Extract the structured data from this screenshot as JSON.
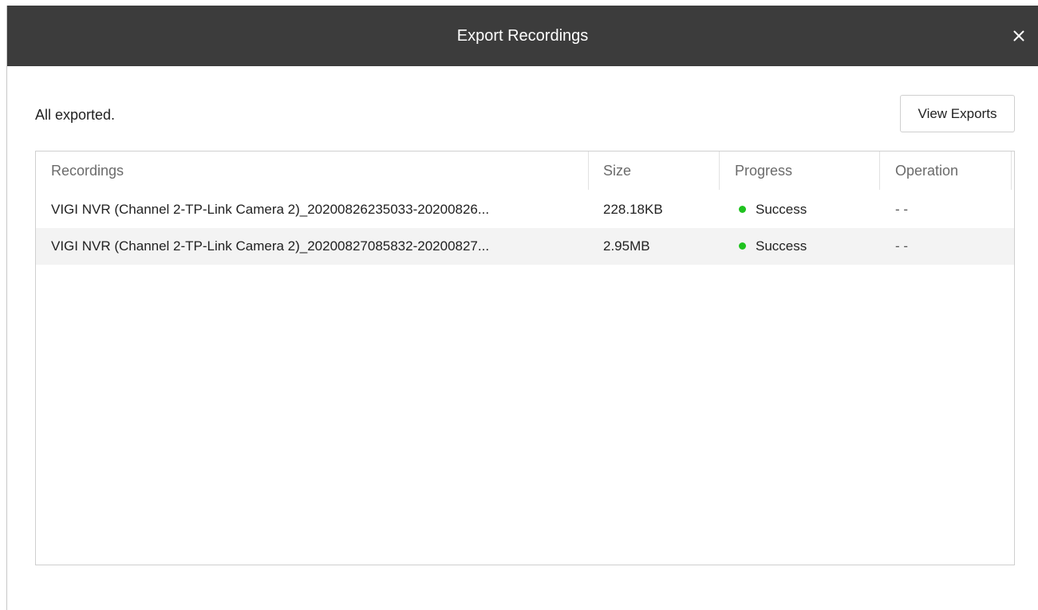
{
  "dialog": {
    "title": "Export Recordings",
    "close_icon": "close-icon"
  },
  "status": {
    "message": "All exported."
  },
  "toolbar": {
    "view_exports_label": "View Exports"
  },
  "table": {
    "columns": [
      "Recordings",
      "Size",
      "Progress",
      "Operation"
    ],
    "rows": [
      {
        "recording": "VIGI NVR (Channel  2-TP-Link Camera 2)_20200826235033-20200826...",
        "size": "228.18KB",
        "progress": "Success",
        "operation": "- -"
      },
      {
        "recording": "VIGI NVR (Channel  2-TP-Link Camera 2)_20200827085832-20200827...",
        "size": "2.95MB",
        "progress": "Success",
        "operation": "- -"
      }
    ]
  },
  "colors": {
    "titlebar": "#3c3c3c",
    "success": "#1fc21f",
    "row_alt": "#f3f3f3"
  }
}
